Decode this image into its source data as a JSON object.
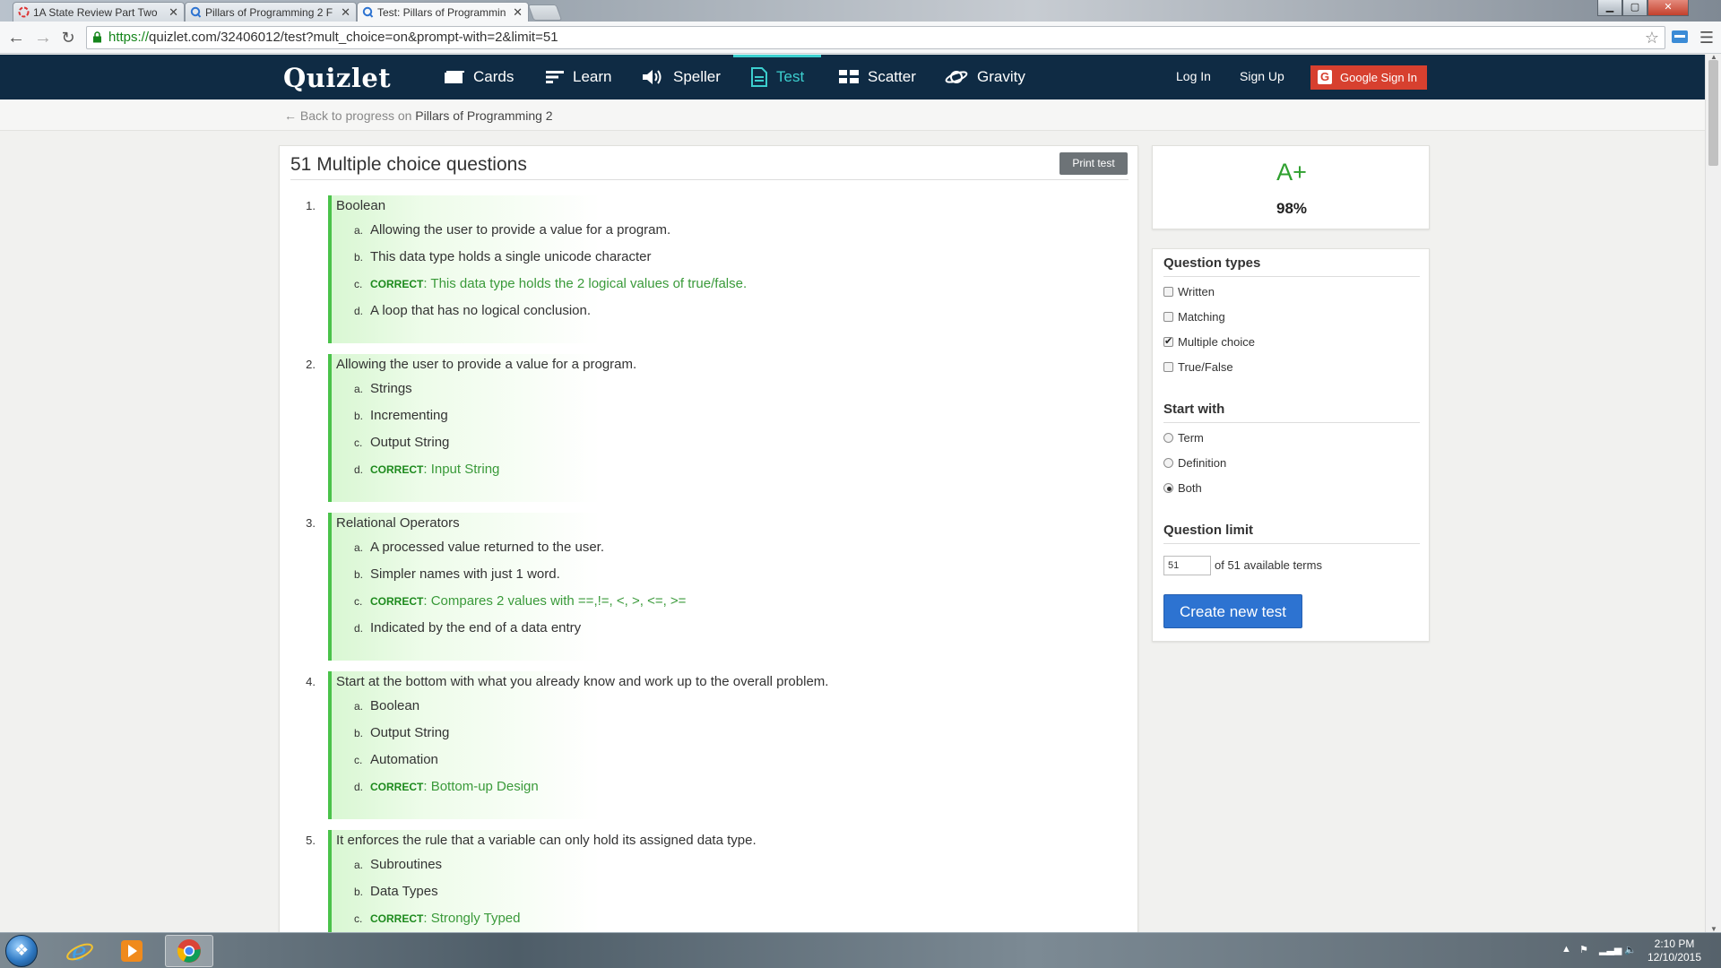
{
  "browser": {
    "tabs": [
      {
        "title": "1A State Review Part Two",
        "icon": "loading-icon"
      },
      {
        "title": "Pillars of Programming 2 F",
        "icon": "quizlet-q-icon"
      },
      {
        "title": "Test: Pillars of Programmin",
        "icon": "quizlet-q-icon",
        "active": true
      }
    ],
    "url_scheme": "https://",
    "url_rest": "quizlet.com/32406012/test?mult_choice=on&prompt-with=2&limit=51"
  },
  "header": {
    "logo": "Quizlet",
    "nav": [
      {
        "label": "Cards",
        "icon": "cards-icon"
      },
      {
        "label": "Learn",
        "icon": "learn-icon"
      },
      {
        "label": "Speller",
        "icon": "speaker-icon"
      },
      {
        "label": "Test",
        "icon": "test-document-icon",
        "active": true
      },
      {
        "label": "Scatter",
        "icon": "scatter-grid-icon"
      },
      {
        "label": "Gravity",
        "icon": "planet-icon"
      }
    ],
    "login": "Log In",
    "signup": "Sign Up",
    "google": "Google Sign In",
    "google_letter": "G"
  },
  "subbar": {
    "back_text": "← Back to progress on",
    "set_name": "Pillars of Programming 2"
  },
  "test": {
    "title": "51 Multiple choice questions",
    "print": "Print test",
    "correct_label": "CORRECT",
    "questions": [
      {
        "num": "1.",
        "prompt": "Boolean",
        "options": [
          {
            "letter": "a.",
            "text": "Allowing the user to provide a value for a program."
          },
          {
            "letter": "b.",
            "text": "This data type holds a single unicode character"
          },
          {
            "letter": "c.",
            "text": "This data type holds the 2 logical values of true/false.",
            "correct": true
          },
          {
            "letter": "d.",
            "text": "A loop that has no logical conclusion."
          }
        ]
      },
      {
        "num": "2.",
        "prompt": "Allowing the user to provide a value for a program.",
        "options": [
          {
            "letter": "a.",
            "text": "Strings"
          },
          {
            "letter": "b.",
            "text": "Incrementing"
          },
          {
            "letter": "c.",
            "text": "Output String"
          },
          {
            "letter": "d.",
            "text": "Input String",
            "correct": true
          }
        ]
      },
      {
        "num": "3.",
        "prompt": "Relational Operators",
        "options": [
          {
            "letter": "a.",
            "text": "A processed value returned to the user."
          },
          {
            "letter": "b.",
            "text": "Simpler names with just 1 word."
          },
          {
            "letter": "c.",
            "text": "Compares 2 values with ==,!=, <, >, <=, >=",
            "correct": true
          },
          {
            "letter": "d.",
            "text": "Indicated by the end of a data entry"
          }
        ]
      },
      {
        "num": "4.",
        "prompt": "Start at the bottom with what you already know and work up to the overall problem.",
        "options": [
          {
            "letter": "a.",
            "text": "Boolean"
          },
          {
            "letter": "b.",
            "text": "Output String"
          },
          {
            "letter": "c.",
            "text": "Automation"
          },
          {
            "letter": "d.",
            "text": "Bottom-up Design",
            "correct": true
          }
        ]
      },
      {
        "num": "5.",
        "prompt": "It enforces the rule that a variable can only hold its assigned data type.",
        "options": [
          {
            "letter": "a.",
            "text": "Subroutines"
          },
          {
            "letter": "b.",
            "text": "Data Types"
          },
          {
            "letter": "c.",
            "text": "Strongly Typed",
            "correct": true
          }
        ]
      }
    ]
  },
  "sidebar": {
    "grade": "A+",
    "percent": "98%",
    "question_types_head": "Question types",
    "question_types": [
      {
        "label": "Written",
        "checked": false
      },
      {
        "label": "Matching",
        "checked": false
      },
      {
        "label": "Multiple choice",
        "checked": true
      },
      {
        "label": "True/False",
        "checked": false
      }
    ],
    "start_with_head": "Start with",
    "start_with": [
      {
        "label": "Term",
        "checked": false
      },
      {
        "label": "Definition",
        "checked": false
      },
      {
        "label": "Both",
        "checked": true
      }
    ],
    "limit_head": "Question limit",
    "limit_value": "51",
    "limit_suffix": "of 51 available terms",
    "create": "Create new test"
  },
  "taskbar": {
    "time": "2:10 PM",
    "date": "12/10/2015"
  },
  "colors": {
    "header_bg": "#0f2b44",
    "accent_teal": "#3ccfcf",
    "correct_green": "#3a9a3a",
    "google_red": "#d7402f",
    "button_blue": "#2d73d1"
  }
}
